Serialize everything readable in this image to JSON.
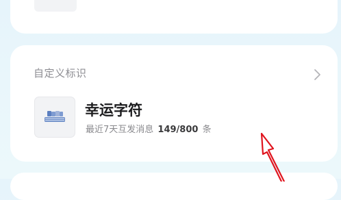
{
  "section": {
    "title": "自定义标识"
  },
  "badge": {
    "name": "幸运字符",
    "stat_prefix": "最近7天互发消息",
    "stat_count": "149/800",
    "stat_suffix": "条"
  },
  "colors": {
    "background": "#e8f5fb",
    "card": "#ffffff",
    "annotation": "#e0141e",
    "badge_icon": "#6f8fc8"
  },
  "icons": {
    "chevron": "chevron-right-icon",
    "badge": "lucky-character-badge-icon"
  }
}
